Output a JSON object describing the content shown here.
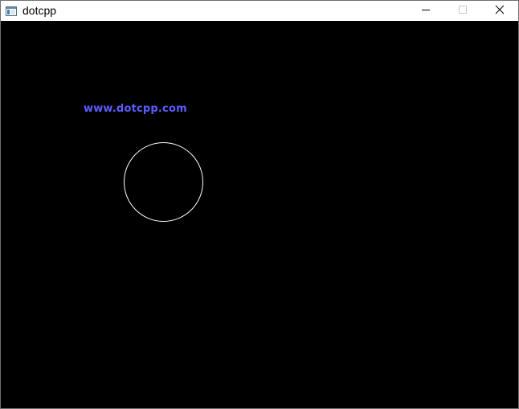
{
  "window": {
    "title": "dotcpp",
    "icon": "app-window-icon",
    "controls": {
      "minimize_icon": "minimize-icon",
      "maximize_icon": "maximize-icon",
      "close_icon": "close-icon"
    }
  },
  "canvas": {
    "background": "#000000",
    "text": "www.dotcpp.com",
    "text_color": "#5c5cff",
    "circle_color": "#ffffff"
  }
}
